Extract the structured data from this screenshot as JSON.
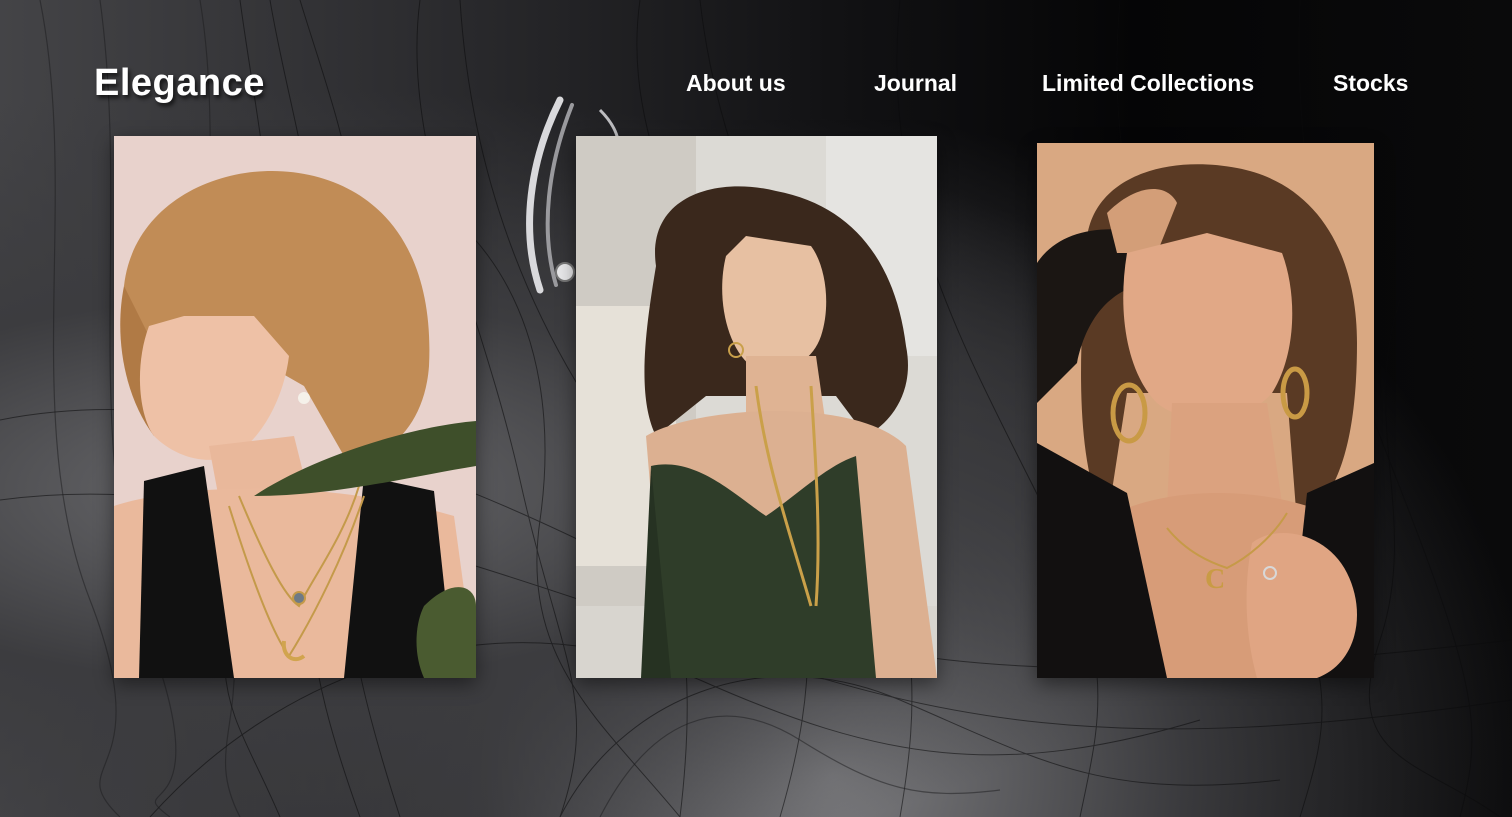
{
  "brand": {
    "logo_text": "Elegance"
  },
  "nav": {
    "items": [
      {
        "label": "About us"
      },
      {
        "label": "Journal"
      },
      {
        "label": "Limited Collections"
      },
      {
        "label": "Stocks"
      }
    ]
  },
  "gallery": {
    "photos": [
      {
        "subject": "woman with blonde bob, profile, gold moon pendant necklaces, black top, leaf"
      },
      {
        "subject": "woman with dark curly hair, green satin slip dress, long gold chain necklaces"
      },
      {
        "subject": "woman with wet wavy hair, large gold hoop earrings, gold letter pendant, black blazer"
      }
    ]
  },
  "colors": {
    "background": "#050506",
    "text": "#ffffff",
    "photo1_bg": "#e9d3cd",
    "photo2_bg": "#d9d7d2",
    "photo3_bg": "#d9a882"
  }
}
